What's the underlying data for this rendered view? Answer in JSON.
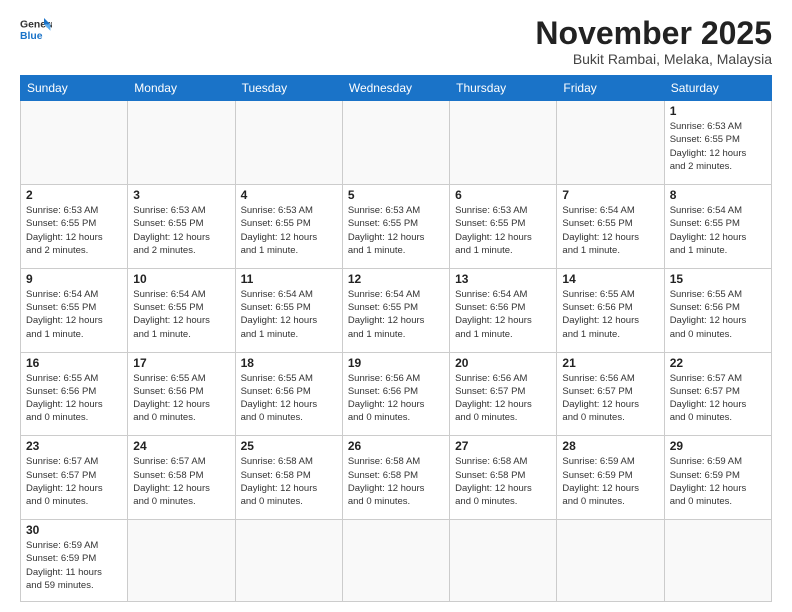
{
  "header": {
    "logo_general": "General",
    "logo_blue": "Blue",
    "month_title": "November 2025",
    "location": "Bukit Rambai, Melaka, Malaysia"
  },
  "weekdays": [
    "Sunday",
    "Monday",
    "Tuesday",
    "Wednesday",
    "Thursday",
    "Friday",
    "Saturday"
  ],
  "weeks": [
    [
      {
        "day": "",
        "info": ""
      },
      {
        "day": "",
        "info": ""
      },
      {
        "day": "",
        "info": ""
      },
      {
        "day": "",
        "info": ""
      },
      {
        "day": "",
        "info": ""
      },
      {
        "day": "",
        "info": ""
      },
      {
        "day": "1",
        "info": "Sunrise: 6:53 AM\nSunset: 6:55 PM\nDaylight: 12 hours\nand 2 minutes."
      }
    ],
    [
      {
        "day": "2",
        "info": "Sunrise: 6:53 AM\nSunset: 6:55 PM\nDaylight: 12 hours\nand 2 minutes."
      },
      {
        "day": "3",
        "info": "Sunrise: 6:53 AM\nSunset: 6:55 PM\nDaylight: 12 hours\nand 2 minutes."
      },
      {
        "day": "4",
        "info": "Sunrise: 6:53 AM\nSunset: 6:55 PM\nDaylight: 12 hours\nand 1 minute."
      },
      {
        "day": "5",
        "info": "Sunrise: 6:53 AM\nSunset: 6:55 PM\nDaylight: 12 hours\nand 1 minute."
      },
      {
        "day": "6",
        "info": "Sunrise: 6:53 AM\nSunset: 6:55 PM\nDaylight: 12 hours\nand 1 minute."
      },
      {
        "day": "7",
        "info": "Sunrise: 6:54 AM\nSunset: 6:55 PM\nDaylight: 12 hours\nand 1 minute."
      },
      {
        "day": "8",
        "info": "Sunrise: 6:54 AM\nSunset: 6:55 PM\nDaylight: 12 hours\nand 1 minute."
      }
    ],
    [
      {
        "day": "9",
        "info": "Sunrise: 6:54 AM\nSunset: 6:55 PM\nDaylight: 12 hours\nand 1 minute."
      },
      {
        "day": "10",
        "info": "Sunrise: 6:54 AM\nSunset: 6:55 PM\nDaylight: 12 hours\nand 1 minute."
      },
      {
        "day": "11",
        "info": "Sunrise: 6:54 AM\nSunset: 6:55 PM\nDaylight: 12 hours\nand 1 minute."
      },
      {
        "day": "12",
        "info": "Sunrise: 6:54 AM\nSunset: 6:55 PM\nDaylight: 12 hours\nand 1 minute."
      },
      {
        "day": "13",
        "info": "Sunrise: 6:54 AM\nSunset: 6:56 PM\nDaylight: 12 hours\nand 1 minute."
      },
      {
        "day": "14",
        "info": "Sunrise: 6:55 AM\nSunset: 6:56 PM\nDaylight: 12 hours\nand 1 minute."
      },
      {
        "day": "15",
        "info": "Sunrise: 6:55 AM\nSunset: 6:56 PM\nDaylight: 12 hours\nand 0 minutes."
      }
    ],
    [
      {
        "day": "16",
        "info": "Sunrise: 6:55 AM\nSunset: 6:56 PM\nDaylight: 12 hours\nand 0 minutes."
      },
      {
        "day": "17",
        "info": "Sunrise: 6:55 AM\nSunset: 6:56 PM\nDaylight: 12 hours\nand 0 minutes."
      },
      {
        "day": "18",
        "info": "Sunrise: 6:55 AM\nSunset: 6:56 PM\nDaylight: 12 hours\nand 0 minutes."
      },
      {
        "day": "19",
        "info": "Sunrise: 6:56 AM\nSunset: 6:56 PM\nDaylight: 12 hours\nand 0 minutes."
      },
      {
        "day": "20",
        "info": "Sunrise: 6:56 AM\nSunset: 6:57 PM\nDaylight: 12 hours\nand 0 minutes."
      },
      {
        "day": "21",
        "info": "Sunrise: 6:56 AM\nSunset: 6:57 PM\nDaylight: 12 hours\nand 0 minutes."
      },
      {
        "day": "22",
        "info": "Sunrise: 6:57 AM\nSunset: 6:57 PM\nDaylight: 12 hours\nand 0 minutes."
      }
    ],
    [
      {
        "day": "23",
        "info": "Sunrise: 6:57 AM\nSunset: 6:57 PM\nDaylight: 12 hours\nand 0 minutes."
      },
      {
        "day": "24",
        "info": "Sunrise: 6:57 AM\nSunset: 6:58 PM\nDaylight: 12 hours\nand 0 minutes."
      },
      {
        "day": "25",
        "info": "Sunrise: 6:58 AM\nSunset: 6:58 PM\nDaylight: 12 hours\nand 0 minutes."
      },
      {
        "day": "26",
        "info": "Sunrise: 6:58 AM\nSunset: 6:58 PM\nDaylight: 12 hours\nand 0 minutes."
      },
      {
        "day": "27",
        "info": "Sunrise: 6:58 AM\nSunset: 6:58 PM\nDaylight: 12 hours\nand 0 minutes."
      },
      {
        "day": "28",
        "info": "Sunrise: 6:59 AM\nSunset: 6:59 PM\nDaylight: 12 hours\nand 0 minutes."
      },
      {
        "day": "29",
        "info": "Sunrise: 6:59 AM\nSunset: 6:59 PM\nDaylight: 12 hours\nand 0 minutes."
      }
    ],
    [
      {
        "day": "30",
        "info": "Sunrise: 6:59 AM\nSunset: 6:59 PM\nDaylight: 11 hours\nand 59 minutes."
      },
      {
        "day": "",
        "info": ""
      },
      {
        "day": "",
        "info": ""
      },
      {
        "day": "",
        "info": ""
      },
      {
        "day": "",
        "info": ""
      },
      {
        "day": "",
        "info": ""
      },
      {
        "day": "",
        "info": ""
      }
    ]
  ]
}
